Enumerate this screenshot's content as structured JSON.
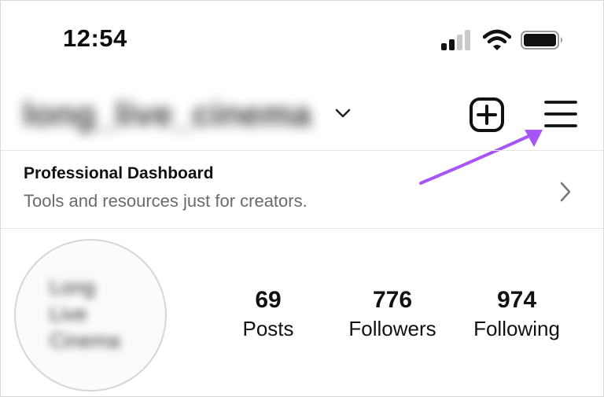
{
  "status_bar": {
    "time": "12:54",
    "icons": [
      "cellular-signal-icon",
      "wifi-icon",
      "battery-icon"
    ]
  },
  "header": {
    "username": "long_live_cinema",
    "username_blurred": true,
    "icons": [
      "chevron-down-icon",
      "new-post-icon",
      "menu-icon"
    ],
    "annotation_arrow_color": "#a855f7"
  },
  "dashboard": {
    "title": "Professional Dashboard",
    "subtitle": "Tools and resources just for creators."
  },
  "profile": {
    "avatar_text": "Long\nLive\nCinema",
    "stats": {
      "posts": {
        "value": "69",
        "label": "Posts"
      },
      "followers": {
        "value": "776",
        "label": "Followers"
      },
      "following": {
        "value": "974",
        "label": "Following"
      }
    }
  },
  "colors": {
    "text": "#111111",
    "secondary_text": "#6b6b6b",
    "divider": "#e6e6e6",
    "arrow": "#a855f7"
  }
}
